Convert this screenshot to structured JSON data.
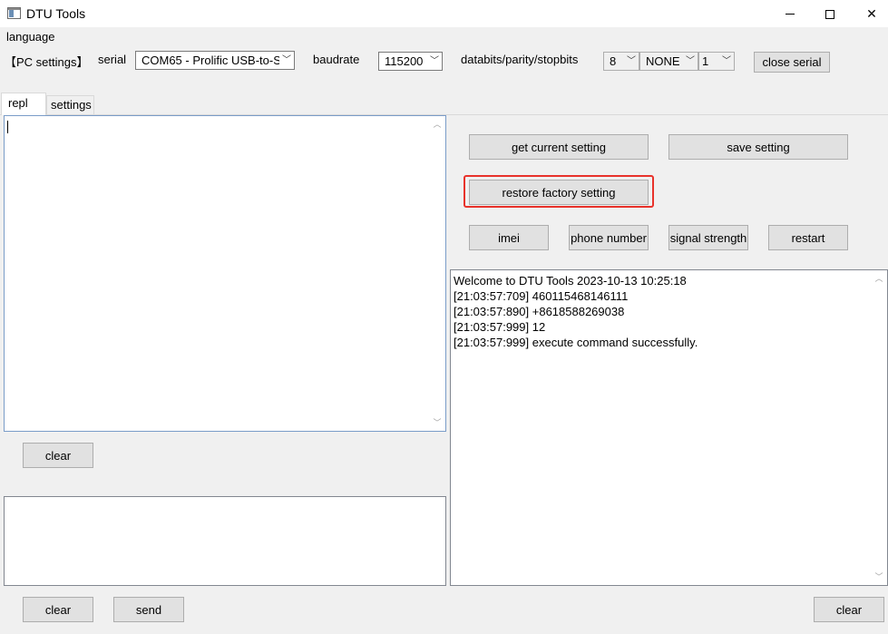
{
  "window": {
    "title": "DTU Tools",
    "minimize_symbol": "",
    "maximize_symbol": "",
    "close_symbol": "✕"
  },
  "menu": {
    "language": "language"
  },
  "pc_settings": {
    "section_label": "【PC settings】",
    "serial_label": "serial",
    "serial_value": "COM65 - Prolific USB-to-S",
    "baudrate_label": "baudrate",
    "baudrate_value": "115200",
    "databits_label": "databits/parity/stopbits",
    "databits_value": "8",
    "parity_value": "NONE",
    "stopbits_value": "1",
    "close_serial_label": "close serial"
  },
  "tabs": [
    {
      "label": "repl",
      "active": true
    },
    {
      "label": "settings",
      "active": false
    }
  ],
  "repl": {
    "output_text": "",
    "clear_label": "clear",
    "input_text": "",
    "bottom_clear_label": "clear",
    "send_label": "send"
  },
  "actions": {
    "get_current_setting": "get current setting",
    "save_setting": "save setting",
    "restore_factory_setting": "restore factory setting",
    "imei": "imei",
    "phone_number": "phone number",
    "signal_strength": "signal strength",
    "restart": "restart"
  },
  "log": {
    "lines": [
      "Welcome to DTU Tools 2023-10-13 10:25:18",
      "[21:03:57:709] 460115468146111",
      "[21:03:57:890] +8618588269038",
      "[21:03:57:999] 12",
      "[21:03:57:999] execute command successfully."
    ],
    "clear_label": "clear"
  },
  "colors": {
    "highlight": "#e8322b",
    "window_bg": "#f0f0f0",
    "button_bg": "#e1e1e1"
  },
  "icons": {
    "app": "app-window-icon",
    "combo_arrow": "chevron-down-icon",
    "scroll_up": "scroll-up-arrow-icon",
    "scroll_down": "scroll-down-arrow-icon"
  }
}
